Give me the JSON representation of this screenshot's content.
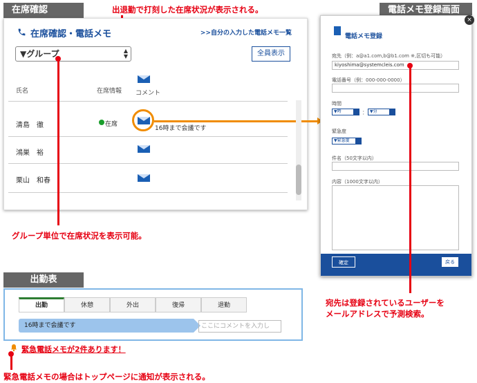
{
  "sections": {
    "attendance_confirm": "在席確認",
    "phone_memo_register": "電話メモ登録画面",
    "attendance_table": "出勤表"
  },
  "annotations": {
    "top": "出退勤で打刻した在席状況が表示される。",
    "group": "グループ単位で在席状況を表示可能。",
    "address": "宛先は登録されているユーザーを\nメールアドレスで予測検索。",
    "urgent_notice": "緊急電話メモの場合はトップページに通知が表示される。"
  },
  "panel1": {
    "title": "在席確認・電話メモ",
    "my_memo_link": ">>自分の入力した電話メモ一覧",
    "group_select": "▼グループ",
    "show_all_button": "全員表示",
    "columns": {
      "name": "氏名",
      "status": "在席情報",
      "comment": "コメント"
    },
    "rows": [
      {
        "name": "清島　徹",
        "status": "在席",
        "comment": "16時まで会議です"
      },
      {
        "name": "鴻巣　裕",
        "status": "",
        "comment": ""
      },
      {
        "name": "栗山　和春",
        "status": "",
        "comment": ""
      }
    ]
  },
  "panel2": {
    "title": "電話メモ登録",
    "to_label": "宛先（例：a@a1.com,b@b1.com ※,区切も可能）",
    "to_value": "kiyoshima@systemcleis.com",
    "phone_label": "電話番号（例：000-000-0000）",
    "time_label": "時間",
    "hour_select": "▼時",
    "time_sep": "：",
    "minute_select": "▼分",
    "urgency_label": "緊急度",
    "urgency_select": "▼緊急度",
    "subject_label": "件名（50文字以内）",
    "content_label": "内容（1000文字以内）",
    "ok_button": "確定",
    "back_button": "戻る",
    "close": "×"
  },
  "panel3": {
    "tabs": [
      "出勤",
      "休憩",
      "外出",
      "復帰",
      "退勤"
    ],
    "active_tab": "出勤",
    "comment": "16時まで会議です",
    "comment_placeholder": "ここにコメントを入力し",
    "urgent_message": "緊急電話メモが2件あります！"
  },
  "colors": {
    "accent_blue": "#1a4f9c",
    "annotation_red": "#e60012",
    "highlight_orange": "#f08c00",
    "present_green": "#1a9d2c"
  }
}
